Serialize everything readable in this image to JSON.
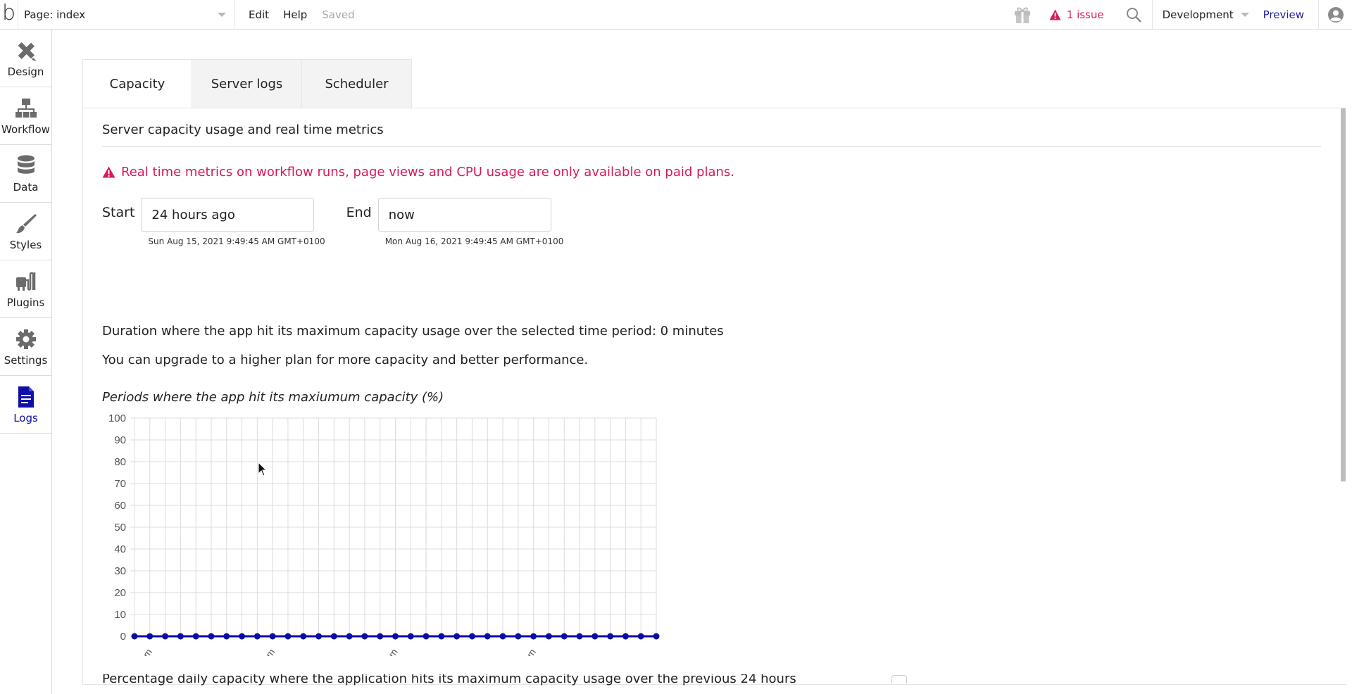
{
  "topbar": {
    "logo": "b",
    "page_selector": "Page: index",
    "menu": [
      "Edit",
      "Help"
    ],
    "save_status": "Saved",
    "issues_label": "1 issue",
    "environment": "Development",
    "preview_label": "Preview"
  },
  "sidebar": {
    "items": [
      {
        "label": "Design",
        "icon": "design-icon",
        "active": false
      },
      {
        "label": "Workflow",
        "icon": "workflow-icon",
        "active": false
      },
      {
        "label": "Data",
        "icon": "database-icon",
        "active": false
      },
      {
        "label": "Styles",
        "icon": "brush-icon",
        "active": false
      },
      {
        "label": "Plugins",
        "icon": "plug-icon",
        "active": false
      },
      {
        "label": "Settings",
        "icon": "gear-icon",
        "active": false
      },
      {
        "label": "Logs",
        "icon": "document-icon",
        "active": true
      }
    ]
  },
  "main": {
    "tabs": [
      {
        "label": "Capacity",
        "active": true
      },
      {
        "label": "Server logs",
        "active": false
      },
      {
        "label": "Scheduler",
        "active": false
      }
    ],
    "panel_title": "Server capacity usage and real time metrics",
    "warning": "Real time metrics on workflow runs, page views and CPU usage are only available on paid plans.",
    "start": {
      "label": "Start",
      "value": "24 hours ago",
      "resolved": "Sun Aug 15, 2021 9:49:45 AM GMT+0100"
    },
    "end": {
      "label": "End",
      "value": "now",
      "resolved": "Mon Aug 16, 2021 9:49:45 AM GMT+0100"
    },
    "duration_text": "Duration where the app hit its maximum capacity usage over the selected time period: 0 minutes",
    "upgrade_text": "You can upgrade to a higher plan for more capacity and better performance.",
    "cutoff_text": "Percentage daily capacity where the application hits its maximum capacity usage over the previous 24 hours"
  },
  "colors": {
    "accent": "#0f0fa8",
    "warning": "#d61a5b",
    "series": "#0a0aa8",
    "grid": "#dcdcdc"
  },
  "chart_data": {
    "type": "line",
    "title": "Periods where the app hit its maxiumum capacity (%)",
    "xlabel": "",
    "ylabel": "",
    "ylim": [
      0,
      100
    ],
    "yticks": [
      0,
      10,
      20,
      30,
      40,
      50,
      60,
      70,
      80,
      90,
      100
    ],
    "grid": true,
    "point_count": 35,
    "x_tick_labels": [
      {
        "index": 1,
        "label": "8:46 am"
      },
      {
        "index": 9,
        "label": "9:00 am"
      },
      {
        "index": 17,
        "label": "9:15 am"
      },
      {
        "index": 26,
        "label": "9:31 am"
      }
    ],
    "series": [
      {
        "name": "capacity",
        "values": [
          0,
          0,
          0,
          0,
          0,
          0,
          0,
          0,
          0,
          0,
          0,
          0,
          0,
          0,
          0,
          0,
          0,
          0,
          0,
          0,
          0,
          0,
          0,
          0,
          0,
          0,
          0,
          0,
          0,
          0,
          0,
          0,
          0,
          0,
          0
        ]
      }
    ]
  }
}
